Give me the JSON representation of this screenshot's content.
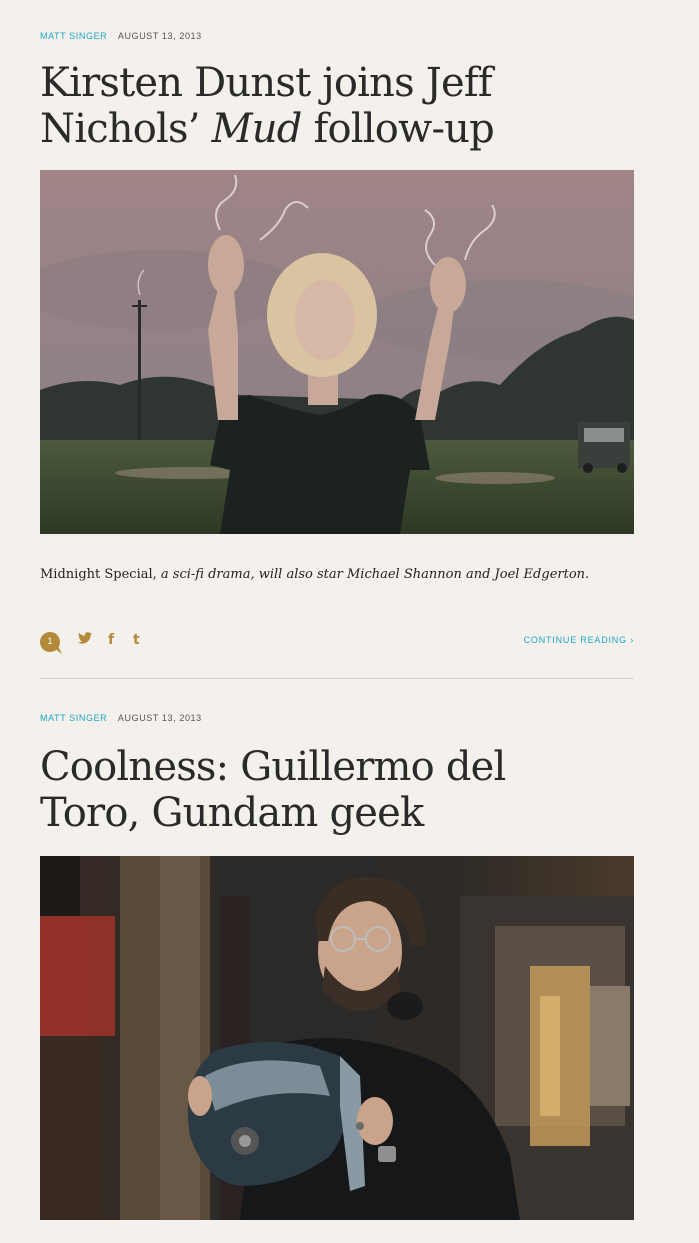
{
  "articles": [
    {
      "author": "Matt Singer",
      "date": "August 13, 2013",
      "title_part1": "Kirsten Dunst joins Jeff Nichols’ ",
      "title_em": "Mud",
      "title_part2": " follow-up",
      "image_alt": "Kirsten Dunst raising her hands on a golf course",
      "dek_roman": "Midnight Special,",
      "dek_italic": " a sci-fi drama, will also star Michael Shannon and Joel Edgerton.",
      "comment_count": "1",
      "share_icons": [
        "twitter-icon",
        "facebook-icon",
        "tumblr-icon"
      ],
      "share_glyphs": [
        "🐦",
        "f",
        "t"
      ],
      "continue_label": "Continue Reading ›"
    },
    {
      "author": "Matt Singer",
      "date": "August 13, 2013",
      "title": "Coolness: Guillermo del Toro, Gundam geek",
      "image_alt": "Guillermo del Toro holding a robot helmet prop"
    }
  ],
  "colors": {
    "background": "#f4f1ec",
    "link_accent": "#1aa6c6",
    "icon_gold": "#b38a3a",
    "title_text": "#2a2a2a"
  }
}
